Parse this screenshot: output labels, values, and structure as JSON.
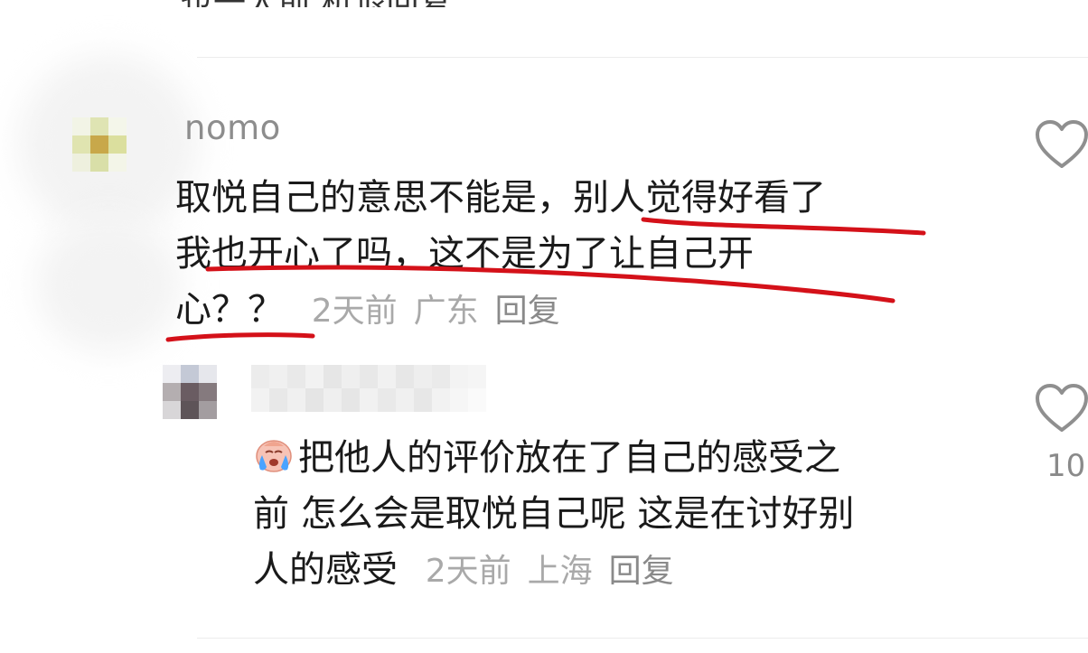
{
  "previous_comment": {
    "clipped_text": "也一人前  杭退回复"
  },
  "comments": [
    {
      "username": "nomo",
      "lines": [
        "取悦自己的意思不能是，别人觉得好看了",
        "我也开心了吗，这不是为了让自己开",
        "心？？"
      ],
      "time": "2天前",
      "location": "广东",
      "reply_label": "回复",
      "liked": false
    }
  ],
  "replies": [
    {
      "username_hidden": true,
      "emoji": "crying-face",
      "lines": [
        "把他人的评价放在了自己的感受之",
        "前 怎么会是取悦自己呢 这是在讨好别",
        "人的感受"
      ],
      "time": "2天前",
      "location": "上海",
      "reply_label": "回复",
      "like_count": "10"
    }
  ],
  "colors": {
    "text_primary": "#1a1a1a",
    "text_meta": "#a9a9a9",
    "annotation_red": "#d41119",
    "divider": "#ececec"
  }
}
